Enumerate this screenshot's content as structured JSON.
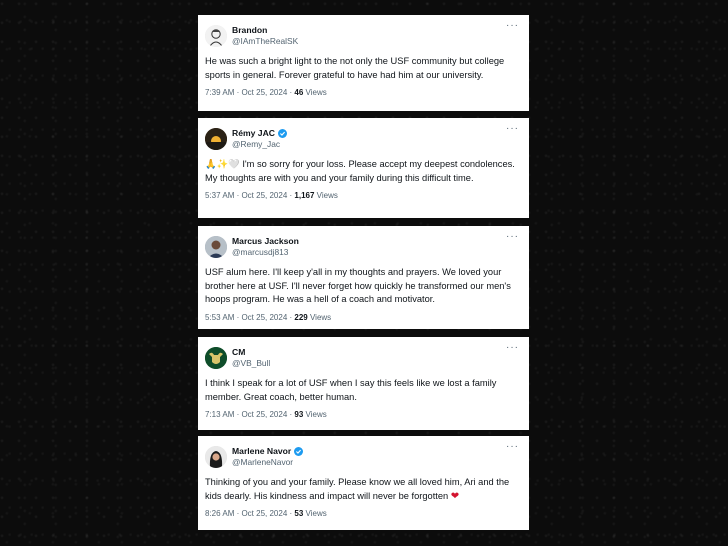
{
  "tweets": [
    {
      "name": "Brandon",
      "handle": "@IAmTheRealSK",
      "verified": false,
      "text": "He was such a bright light to the not only the USF community but college sports in general. Forever grateful to have had him at our university.",
      "time": "7:39 AM · Oct 25, 2024 · ",
      "views_count": "46",
      "views_label": " Views",
      "more": "···"
    },
    {
      "name": "Rémy JAC",
      "handle": "@Remy_Jac",
      "verified": true,
      "emoji": "🙏✨🤍",
      "text": " I'm so sorry for your loss. Please accept my deepest condolences.\nMy thoughts are with you and your family during this difficult time.",
      "time": "5:37 AM · Oct 25, 2024 · ",
      "views_count": "1,167",
      "views_label": " Views",
      "more": "···"
    },
    {
      "name": "Marcus Jackson",
      "handle": "@marcusdj813",
      "verified": false,
      "text": "USF alum here.  I'll keep y'all in my thoughts and prayers.  We loved your brother here at USF.  I'll never forget how quickly he transformed our men's hoops program.  He was a hell of a coach and motivator.",
      "time": "5:53 AM · Oct 25, 2024 · ",
      "views_count": "229",
      "views_label": " Views",
      "more": "···"
    },
    {
      "name": "CM",
      "handle": "@VB_Bull",
      "verified": false,
      "text": "I think I speak for a lot of USF when I say this feels like we lost a family member. Great coach, better human.",
      "time": "7:13 AM · Oct 25, 2024 · ",
      "views_count": "93",
      "views_label": " Views",
      "more": "···"
    },
    {
      "name": "Marlene Navor",
      "handle": "@MarleneNavor",
      "verified": true,
      "text": "Thinking of you and your family. Please know we all loved him, Ari and the kids dearly. His kindness and impact will never be forgotten ",
      "emoji_end": "❤",
      "time": "8:26 AM · Oct 25, 2024 · ",
      "views_count": "53",
      "views_label": " Views",
      "more": "···"
    }
  ]
}
